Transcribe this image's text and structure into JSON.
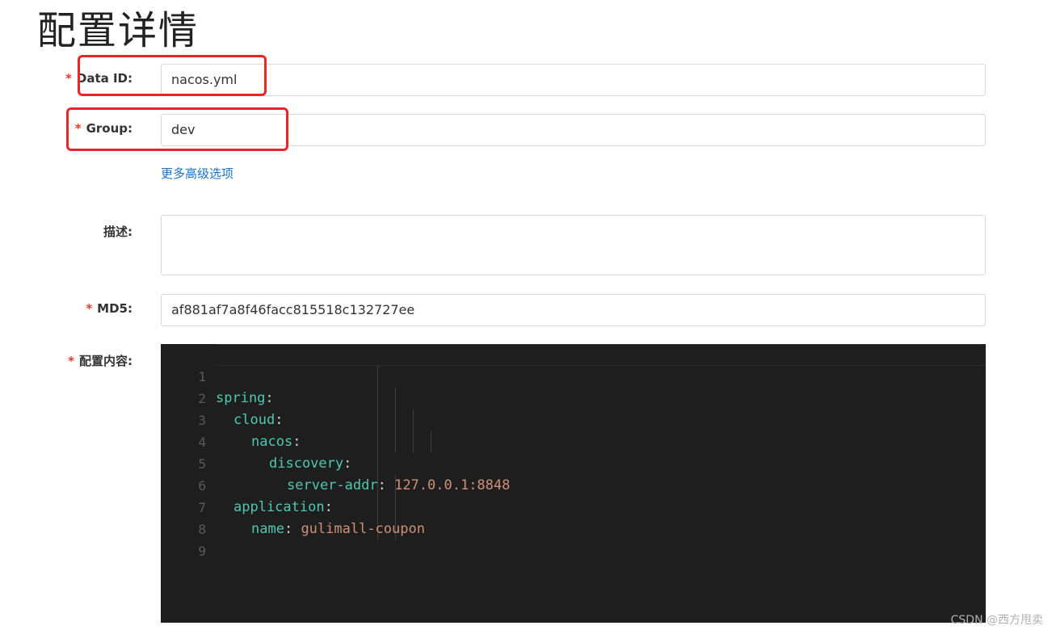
{
  "page": {
    "title": "配置详情"
  },
  "form": {
    "data_id": {
      "label": "Data ID:",
      "value": "nacos.yml",
      "required": true
    },
    "group": {
      "label": "Group:",
      "value": "dev",
      "required": true
    },
    "advanced_link": "更多高级选项",
    "description": {
      "label": "描述:",
      "value": ""
    },
    "md5": {
      "label": "MD5:",
      "value": "af881af7a8f46facc815518c132727ee",
      "required": true
    },
    "content": {
      "label": "配置内容:",
      "required": true
    },
    "required_mark": "*"
  },
  "editor": {
    "lines": [
      {
        "num": "1",
        "key": "spring",
        "sep": ":",
        "value": ""
      },
      {
        "num": "2",
        "key": "cloud",
        "sep": ":",
        "value": ""
      },
      {
        "num": "3",
        "key": "nacos",
        "sep": ":",
        "value": ""
      },
      {
        "num": "4",
        "key": "discovery",
        "sep": ":",
        "value": ""
      },
      {
        "num": "5",
        "key": "server-addr",
        "sep": ": ",
        "value": "127.0.0.1:8848"
      },
      {
        "num": "6",
        "key": "application",
        "sep": ":",
        "value": ""
      },
      {
        "num": "7",
        "key": "name",
        "sep": ": ",
        "value": "gulimall-coupon"
      },
      {
        "num": "8",
        "key": "",
        "sep": "",
        "value": ""
      },
      {
        "num": "9",
        "key": "",
        "sep": "",
        "value": ""
      }
    ],
    "colors": {
      "key": "#4ec9b0",
      "value": "#ce9178",
      "background": "#1e1e1e"
    }
  },
  "highlight_color": "#e8262a",
  "watermark": "CSDN @西方甩卖"
}
